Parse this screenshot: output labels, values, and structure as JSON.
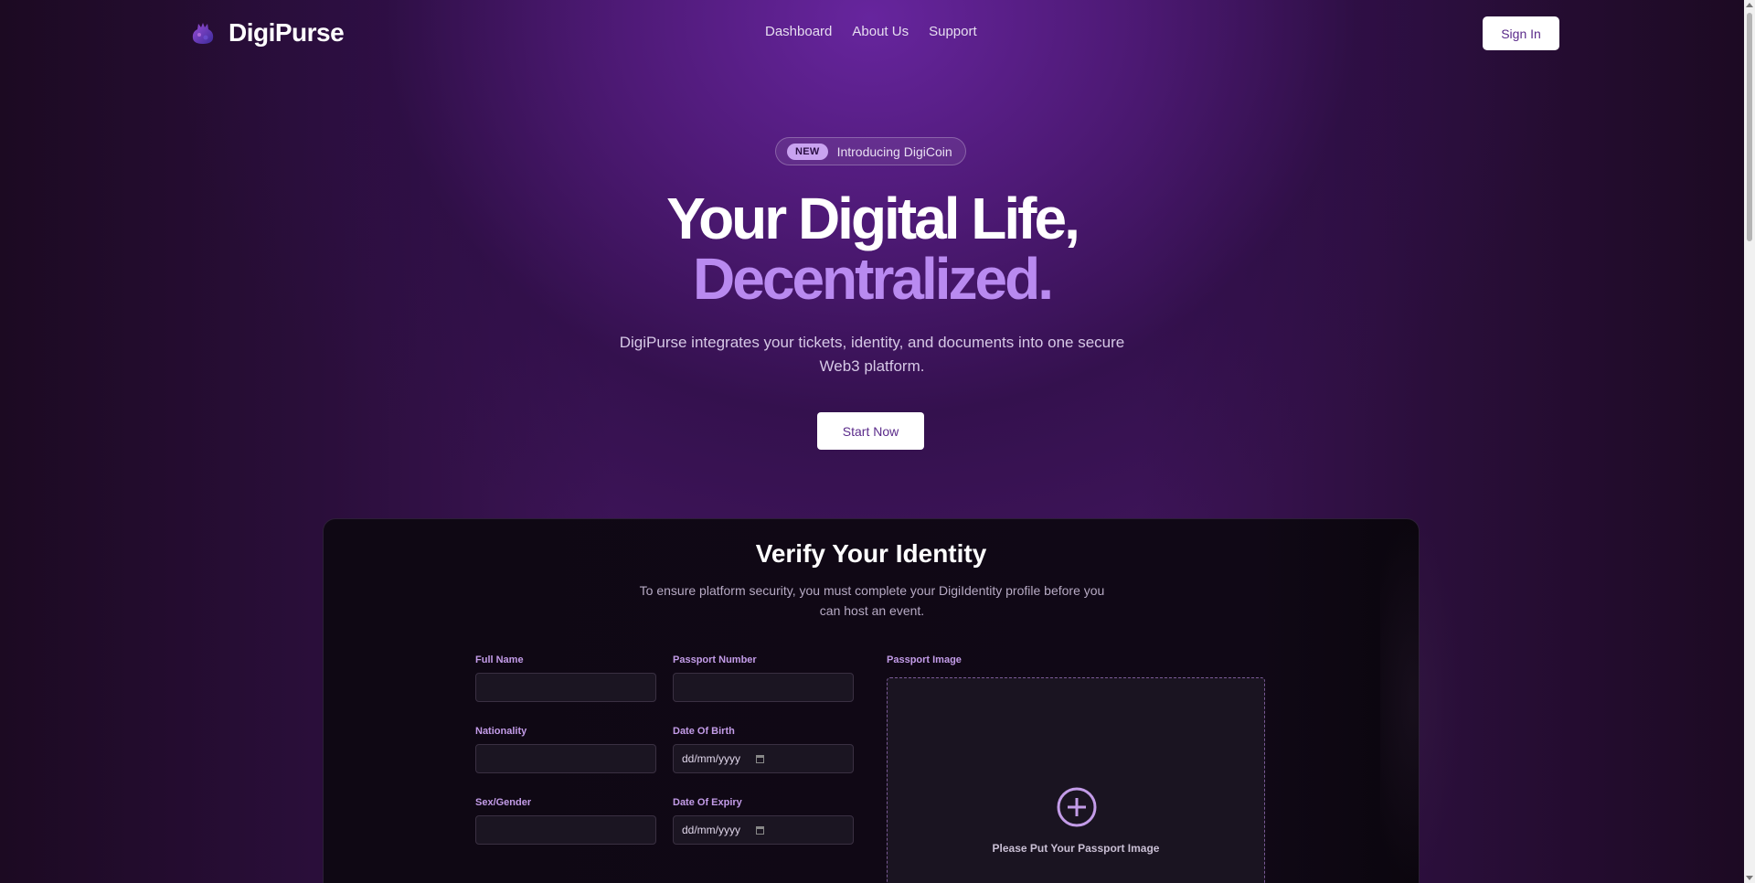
{
  "brand": {
    "name": "DigiPurse",
    "logo_icon": "purse-logo-icon",
    "accent": "#b98af0"
  },
  "nav": {
    "links": [
      "Dashboard",
      "About Us",
      "Support"
    ],
    "signin_label": "Sign In"
  },
  "hero": {
    "badge_tag": "NEW",
    "badge_text": "Introducing DigiCoin",
    "title_line1": "Your Digital Life,",
    "title_line2": "Decentralized.",
    "subtitle": "DigiPurse integrates your tickets, identity, and documents into one secure Web3 platform.",
    "cta_label": "Start Now"
  },
  "verify": {
    "title": "Verify Your Identity",
    "subtitle": "To ensure platform security, you must complete your DigiIdentity profile before you can host an event.",
    "fields": {
      "full_name": {
        "label": "Full Name",
        "value": ""
      },
      "passport_number": {
        "label": "Passport Number",
        "value": ""
      },
      "nationality": {
        "label": "Nationality",
        "value": ""
      },
      "date_of_birth": {
        "label": "Date Of Birth",
        "placeholder": "dd/mm/yyyy"
      },
      "sex_gender": {
        "label": "Sex/Gender",
        "value": ""
      },
      "date_of_expiry": {
        "label": "Date Of Expiry",
        "placeholder": "dd/mm/yyyy"
      }
    },
    "passport_image": {
      "label": "Passport Image",
      "drop_text": "Please Put Your Passport Image",
      "icon": "plus-circle-icon"
    }
  }
}
